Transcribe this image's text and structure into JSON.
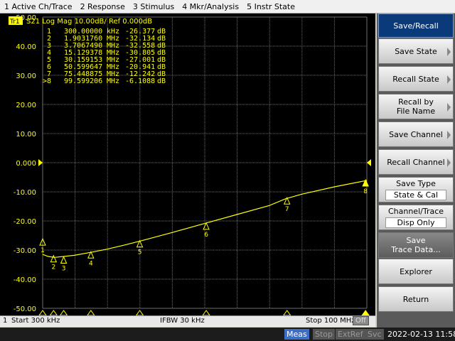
{
  "menu": [
    "1 Active Ch/Trace",
    "2 Response",
    "3 Stimulus",
    "4 Mkr/Analysis",
    "5 Instr State"
  ],
  "trace": {
    "badge": "Tr1",
    "header": "S21 Log Mag 10.00dB/ Ref 0.000dB"
  },
  "markers": [
    {
      "num": "1",
      "active": false,
      "freq": "300.00000",
      "unit": "kHz",
      "value": "-26.377",
      "vunit": "dB",
      "x_mhz": 0.3,
      "y_db": -26.377
    },
    {
      "num": "2",
      "active": false,
      "freq": "1.9031760",
      "unit": "MHz",
      "value": "-32.134",
      "vunit": "dB",
      "x_mhz": 1.903176,
      "y_db": -32.134
    },
    {
      "num": "3",
      "active": false,
      "freq": "3.7067490",
      "unit": "MHz",
      "value": "-32.558",
      "vunit": "dB",
      "x_mhz": 3.706749,
      "y_db": -32.558
    },
    {
      "num": "4",
      "active": false,
      "freq": "15.129378",
      "unit": "MHz",
      "value": "-30.805",
      "vunit": "dB",
      "x_mhz": 15.129378,
      "y_db": -30.805
    },
    {
      "num": "5",
      "active": false,
      "freq": "30.159153",
      "unit": "MHz",
      "value": "-27.001",
      "vunit": "dB",
      "x_mhz": 30.159153,
      "y_db": -27.001
    },
    {
      "num": "6",
      "active": false,
      "freq": "50.599647",
      "unit": "MHz",
      "value": "-20.941",
      "vunit": "dB",
      "x_mhz": 50.599647,
      "y_db": -20.941
    },
    {
      "num": "7",
      "active": false,
      "freq": "75.448875",
      "unit": "MHz",
      "value": "-12.242",
      "vunit": "dB",
      "x_mhz": 75.448875,
      "y_db": -12.242
    },
    {
      "num": "8",
      "active": true,
      "freq": "99.599206",
      "unit": "MHz",
      "value": "-6.1088",
      "vunit": "dB",
      "x_mhz": 99.599206,
      "y_db": -6.1088
    }
  ],
  "chart_data": {
    "type": "line",
    "ylim": [
      -50,
      50
    ],
    "xlim_mhz": [
      0.3,
      100
    ],
    "yticks": [
      "50.00",
      "40.00",
      "30.00",
      "20.00",
      "10.00",
      "0.000",
      "-10.00",
      "-20.00",
      "-30.00",
      "-40.00",
      "-50.00"
    ],
    "ref_value": 0,
    "grid": true,
    "series": [
      {
        "x": [
          0.3,
          2,
          4,
          10,
          15,
          20,
          25,
          30,
          40,
          50,
          60,
          70,
          75,
          80,
          90,
          100
        ],
        "y": [
          -31.5,
          -32.2,
          -32.5,
          -31.8,
          -30.8,
          -29.7,
          -28.4,
          -27.0,
          -24.0,
          -20.9,
          -17.8,
          -14.7,
          -12.4,
          -10.8,
          -8.3,
          -6.1
        ]
      }
    ]
  },
  "footer": {
    "channel": "1",
    "start": "Start 300 kHz",
    "ifbw": "IFBW 30 kHz",
    "stop": "Stop 100 MHz",
    "off": "Off"
  },
  "status": {
    "meas": "Meas",
    "stop": "Stop",
    "extref": "ExtRef",
    "svc": "Svc",
    "datetime": "2022-02-13 11:58"
  },
  "softkeys": {
    "title": "Save/Recall",
    "save_state": "Save State",
    "recall_state": "Recall State",
    "recall_by_line1": "Recall by",
    "recall_by_line2": "File Name",
    "save_channel": "Save Channel",
    "recall_channel": "Recall Channel",
    "save_type": "Save Type",
    "save_type_value": "State & Cal",
    "channel_trace": "Channel/Trace",
    "channel_trace_value": "Disp Only",
    "save_trace_line1": "Save",
    "save_trace_line2": "Trace Data...",
    "explorer": "Explorer",
    "return": "Return"
  },
  "colors": {
    "trace": "#ffff00",
    "grid": "#6e6e6e",
    "label": "#ffff00",
    "background": "#000000"
  }
}
